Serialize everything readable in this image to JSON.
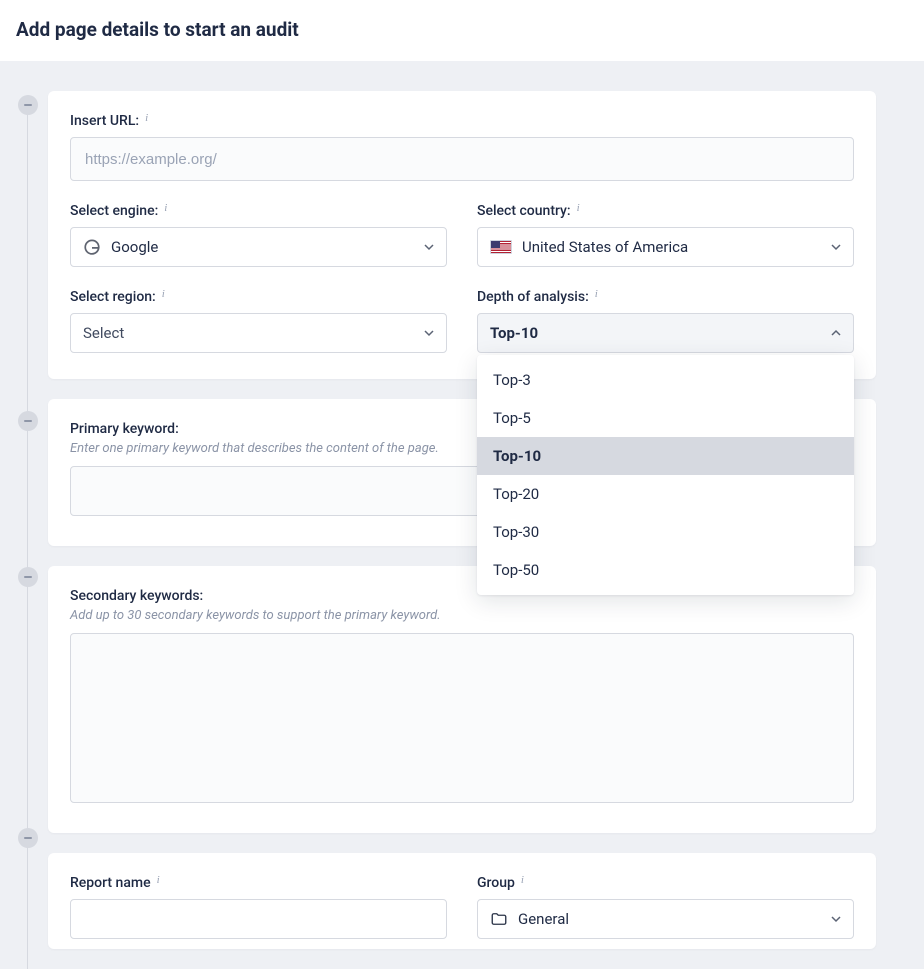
{
  "header": {
    "title": "Add page details to start an audit"
  },
  "step1": {
    "url_label": "Insert URL:",
    "url_placeholder": "https://example.org/",
    "engine_label": "Select engine:",
    "engine_value": "Google",
    "country_label": "Select country:",
    "country_value": "United States of America",
    "region_label": "Select region:",
    "region_value": "Select",
    "depth_label": "Depth of analysis:",
    "depth_value": "Top-10",
    "depth_options": [
      {
        "label": "Top-3",
        "selected": false
      },
      {
        "label": "Top-5",
        "selected": false
      },
      {
        "label": "Top-10",
        "selected": true
      },
      {
        "label": "Top-20",
        "selected": false
      },
      {
        "label": "Top-30",
        "selected": false
      },
      {
        "label": "Top-50",
        "selected": false
      }
    ]
  },
  "step2": {
    "label": "Primary keyword:",
    "caption": "Enter one primary keyword that describes the content of the page."
  },
  "step3": {
    "label": "Secondary keywords:",
    "caption": "Add up to 30 secondary keywords to support the primary keyword."
  },
  "step4": {
    "report_label": "Report name",
    "group_label": "Group",
    "group_value": "General"
  }
}
